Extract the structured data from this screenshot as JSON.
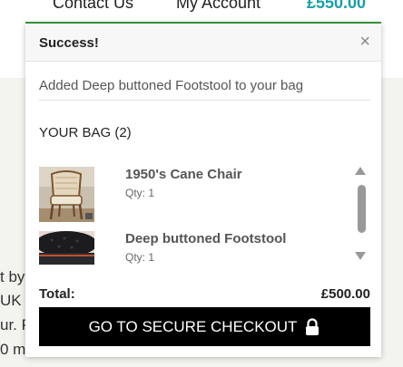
{
  "nav": {
    "contact": "Contact Us",
    "account": "My Account",
    "total": "£550.00"
  },
  "background_text": [
    "t by",
    "UK",
    "ur. P",
    "0 m"
  ],
  "popup": {
    "title": "Success!",
    "close_icon": "×",
    "message": "Added Deep buttoned Footstool to your bag",
    "bag_heading": "YOUR BAG (2)",
    "items": [
      {
        "name": "1950's Cane Chair",
        "qty": "Qty: 1",
        "thumbnail": "cane-chair-image"
      },
      {
        "name": "Deep buttoned Footstool",
        "qty": "Qty: 1",
        "thumbnail": "footstool-image"
      }
    ],
    "total_label": "Total:",
    "total_value": "£500.00",
    "checkout_label": "GO TO SECURE CHECKOUT",
    "checkout_icon": "lock-icon"
  },
  "colors": {
    "accent_teal": "#1a9fa6",
    "underline_green": "#3a9b3a",
    "button_black": "#000000"
  }
}
